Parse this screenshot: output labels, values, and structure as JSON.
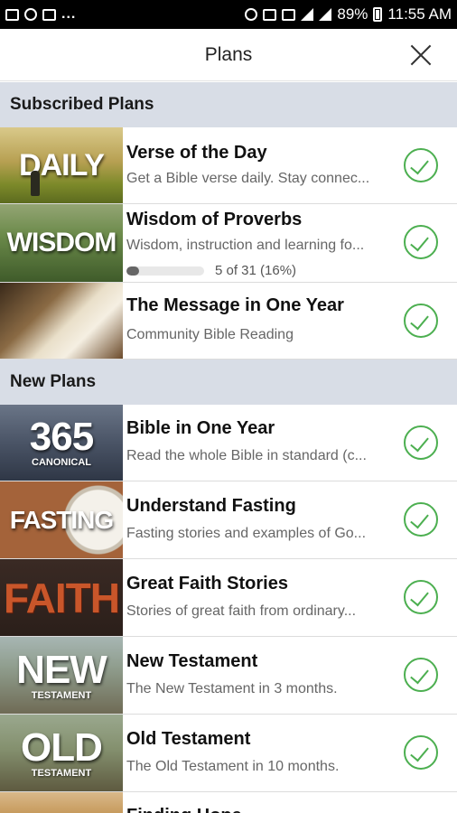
{
  "status_bar": {
    "battery": "89%",
    "time": "11:55 AM"
  },
  "header": {
    "title": "Plans"
  },
  "sections": {
    "subscribed": "Subscribed Plans",
    "new": "New Plans"
  },
  "subscribed_plans": [
    {
      "thumb_text": "DAILY",
      "title": "Verse of the Day",
      "description": "Get a Bible verse daily. Stay connec..."
    },
    {
      "thumb_text": "WISDOM",
      "title": "Wisdom of Proverbs",
      "description": "Wisdom, instruction and learning fo...",
      "progress_label": "5 of 31 (16%)",
      "progress_fraction": 0.16
    },
    {
      "thumb_text": "",
      "title": "The Message in One Year",
      "description": "Community Bible Reading"
    }
  ],
  "new_plans": [
    {
      "thumb_text": "365",
      "thumb_sub": "CANONICAL",
      "title": "Bible in One Year",
      "description": "Read the whole Bible in standard (c..."
    },
    {
      "thumb_text": "FASTING",
      "title": "Understand Fasting",
      "description": "Fasting stories and examples of Go..."
    },
    {
      "thumb_text": "FAITH",
      "title": "Great Faith Stories",
      "description": "Stories of great faith from ordinary..."
    },
    {
      "thumb_text": "NEW",
      "thumb_sub": "TESTAMENT",
      "title": "New Testament",
      "description": "The New Testament in 3 months."
    },
    {
      "thumb_text": "OLD",
      "thumb_sub": "TESTAMENT",
      "title": "Old Testament",
      "description": "The Old Testament in 10 months."
    },
    {
      "thumb_text": "",
      "title": "Finding Hope",
      "description": ""
    }
  ],
  "colors": {
    "check_green": "#4caf50",
    "section_bg": "#d8dde6"
  },
  "icons": {
    "close": "close-icon",
    "subscribed": "check-circle-icon"
  }
}
